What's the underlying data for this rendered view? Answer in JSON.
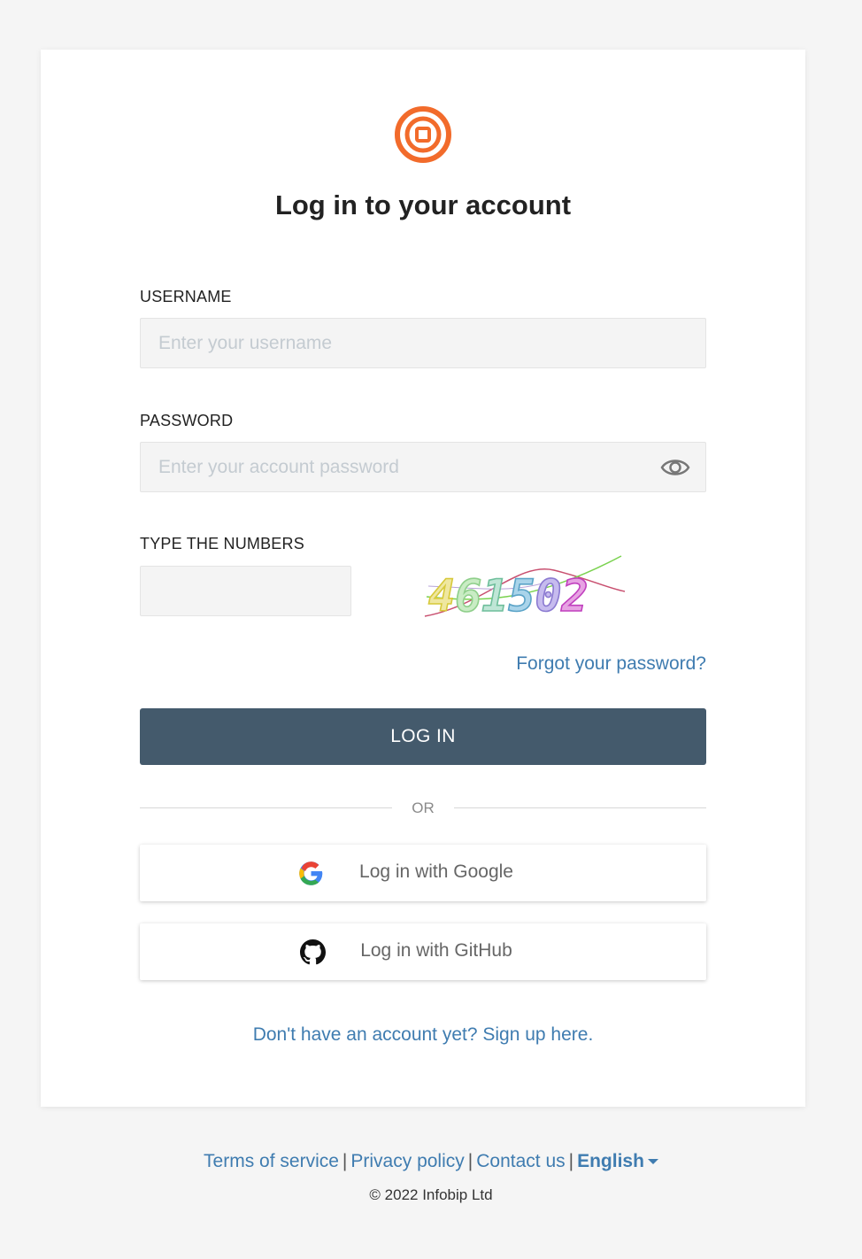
{
  "colors": {
    "brand": "#f26b2b",
    "primary_button": "#445a6c",
    "link": "#3f7cb0"
  },
  "header": {
    "logo_icon": "infobip-logo-icon",
    "title": "Log in to your account"
  },
  "form": {
    "username": {
      "label": "USERNAME",
      "value": "",
      "placeholder": "Enter your username"
    },
    "password": {
      "label": "PASSWORD",
      "value": "",
      "placeholder": "Enter your account password",
      "toggle_icon": "eye-icon"
    },
    "captcha": {
      "label": "TYPE THE NUMBERS",
      "value": "",
      "image_text": "461502"
    },
    "forgot_link": "Forgot your password?",
    "login_button": "LOG IN",
    "divider": "OR",
    "google_button": "Log in with Google",
    "github_button": "Log in with GitHub",
    "signup_link": "Don't have an account yet? Sign up here."
  },
  "footer": {
    "terms": "Terms of service",
    "privacy": "Privacy policy",
    "contact": "Contact us",
    "separator": "|",
    "language": "English",
    "copyright": "© 2022 Infobip Ltd"
  }
}
